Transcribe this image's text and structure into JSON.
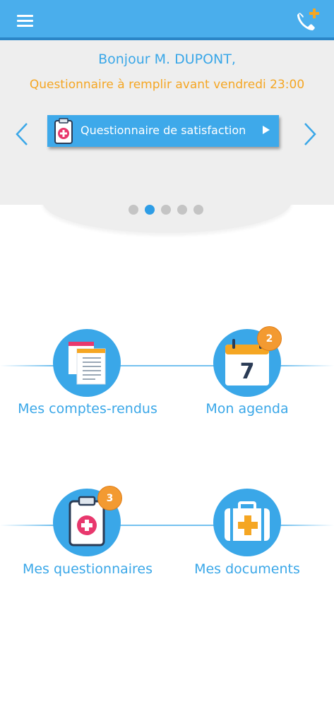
{
  "header": {
    "menu_icon": "hamburger-menu-icon",
    "phone_icon": "phone-plus-icon",
    "colors": {
      "bar": "#4aaeec",
      "bar_border": "#2b86c7",
      "accent": "#f5a623"
    }
  },
  "welcome": {
    "greeting": "Bonjour M. DUPONT,",
    "deadline": "Questionnaire à remplir avant vendredi 23:00",
    "survey_button_label": "Questionnaire de satisfaction",
    "carousel_dots": 5,
    "active_dot": 2
  },
  "tiles": [
    {
      "label": "Mes comptes-rendus",
      "icon": "reports-icon",
      "badge": null
    },
    {
      "label": "Mon agenda",
      "icon": "calendar-icon",
      "badge": "2",
      "calendar_day": "7"
    },
    {
      "label": "Mes questionnaires",
      "icon": "clipboard-icon",
      "badge": "3"
    },
    {
      "label": "Mes documents",
      "icon": "medical-case-icon",
      "badge": null
    }
  ]
}
